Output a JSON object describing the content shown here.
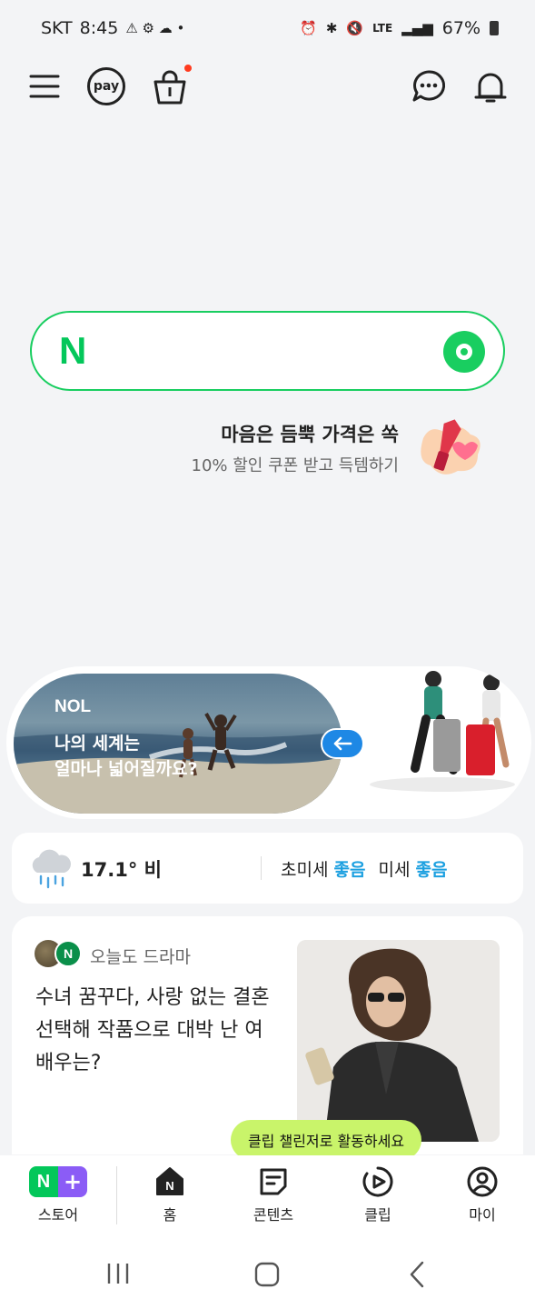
{
  "status_bar": {
    "carrier": "SKT",
    "time": "8:45",
    "network": "LTE",
    "battery": "67%"
  },
  "top_bar": {
    "pay_label": "pay",
    "icons": [
      "menu-icon",
      "pay-icon",
      "shopping-bag-icon",
      "chat-icon",
      "bell-icon"
    ]
  },
  "search": {
    "logo": "N"
  },
  "promo": {
    "title": "마음은 듬뿍 가격은 쏙",
    "subtitle": "10% 할인 쿠폰 받고 득템하기"
  },
  "banner": {
    "brand": "NOL",
    "line1": "나의 세계는",
    "line2": "얼마나 넓어질까요?"
  },
  "weather": {
    "temperature": "17.1° 비",
    "fine_dust_label": "초미세",
    "fine_dust_value": "좋음",
    "dust_label": "미세",
    "dust_value": "좋음"
  },
  "news": {
    "source": "오늘도 드라마",
    "title": "수녀 꿈꾸다, 사랑 없는 결혼 선택해 작품으로 대박 난 여배우는?"
  },
  "tooltip": "클립 챌린저로 활동하세요",
  "bottom_nav": {
    "store_left": "N",
    "store_right": "+",
    "items": [
      {
        "label": "스토어",
        "icon": "store-icon"
      },
      {
        "label": "홈",
        "icon": "home-icon"
      },
      {
        "label": "콘텐츠",
        "icon": "contents-icon"
      },
      {
        "label": "클립",
        "icon": "clip-icon"
      },
      {
        "label": "마이",
        "icon": "profile-icon"
      }
    ]
  },
  "colors": {
    "brand_green": "#03c75a",
    "accent_blue": "#1ca0e0",
    "tooltip_lime": "#c9f46a",
    "store_purple": "#8b5cf6"
  }
}
